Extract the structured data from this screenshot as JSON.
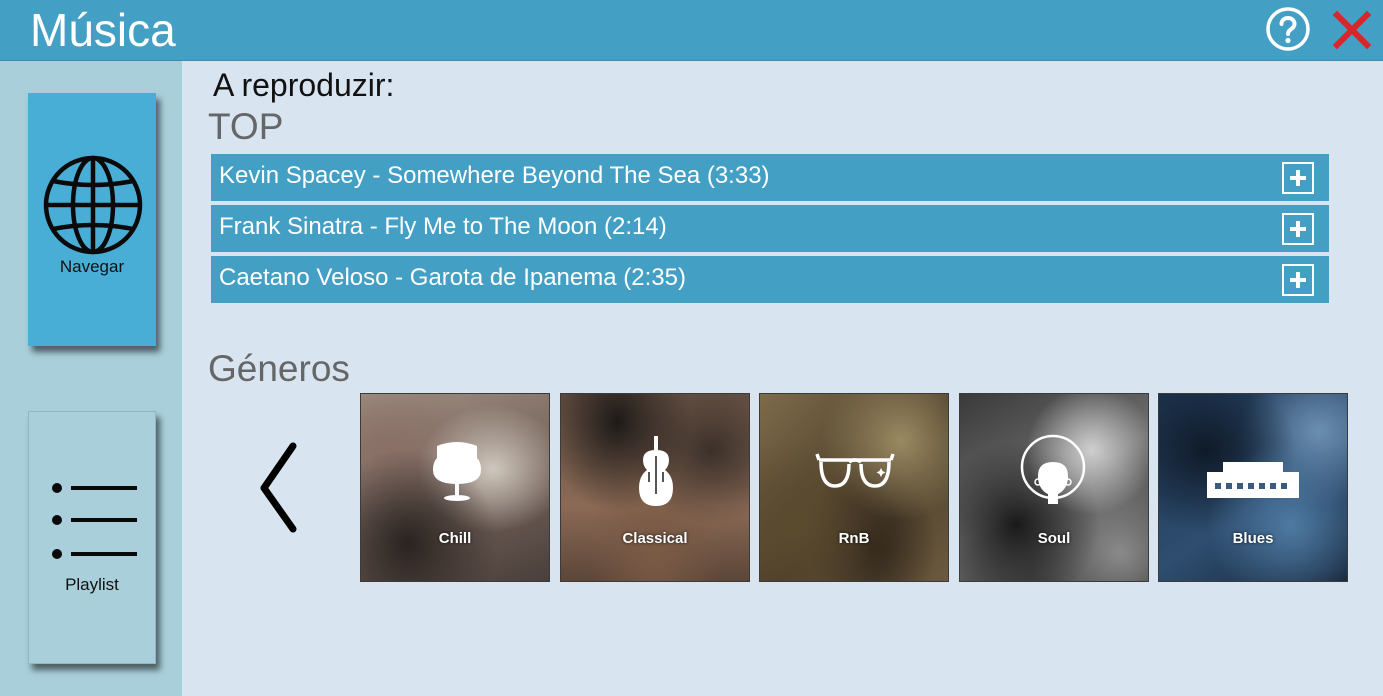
{
  "header": {
    "title": "Música",
    "help_icon": "question-circle-icon",
    "close_icon": "close-x-icon",
    "close_color": "#d9262a",
    "bg_color": "#439fc4"
  },
  "sidebar": {
    "items": [
      {
        "label": "Navegar",
        "icon": "globe-icon"
      },
      {
        "label": "Playlist",
        "icon": "list-icon"
      }
    ]
  },
  "main": {
    "now_playing_label": "A reproduzir:",
    "top_title": "TOP",
    "tracks": [
      {
        "label": "Kevin Spacey - Somewhere Beyond The Sea (3:33)"
      },
      {
        "label": "Frank Sinatra - Fly Me to The Moon (2:14)"
      },
      {
        "label": "Caetano Veloso - Garota de Ipanema (2:35)"
      }
    ],
    "genres_title": "Géneros",
    "genres": [
      {
        "label": "Chill",
        "icon": "egg-chair-icon"
      },
      {
        "label": "Classical",
        "icon": "violin-icon"
      },
      {
        "label": "RnB",
        "icon": "sunglasses-icon"
      },
      {
        "label": "Soul",
        "icon": "afro-head-icon"
      },
      {
        "label": "Blues",
        "icon": "harmonica-icon"
      }
    ]
  }
}
